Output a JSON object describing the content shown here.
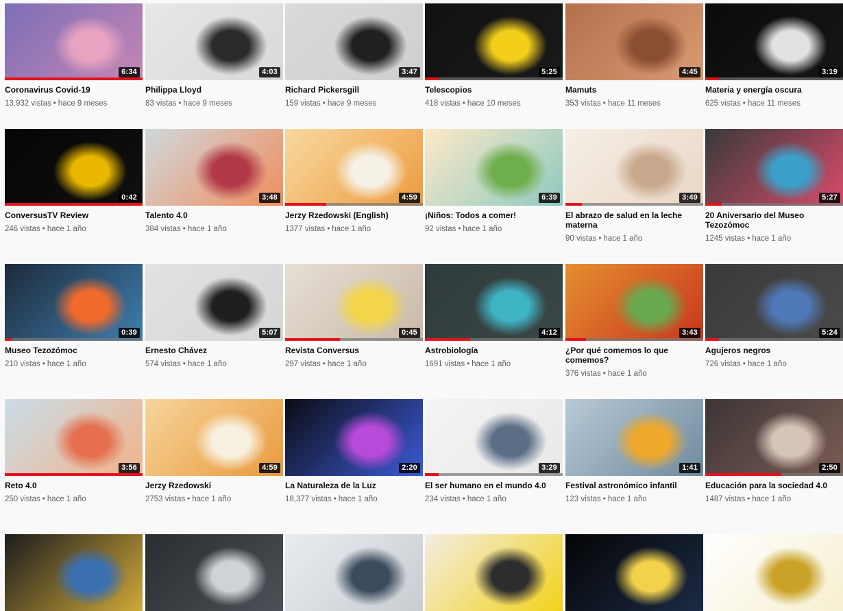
{
  "videos": [
    {
      "title": "Coronavirus Covid-19",
      "views": "13,932 vistas",
      "age": "hace 9 meses",
      "duration": "6:34",
      "progress": 1.0,
      "thumb_colors": [
        "#7c6fb8",
        "#c486b3",
        "#e7a3c0"
      ]
    },
    {
      "title": "Philippa Lloyd",
      "views": "83 vistas",
      "age": "hace 9 meses",
      "duration": "4:03",
      "progress": 0,
      "thumb_colors": [
        "#e7e7e7",
        "#d9d9d9",
        "#2a2a2a"
      ]
    },
    {
      "title": "Richard Pickersgill",
      "views": "159 vistas",
      "age": "hace 9 meses",
      "duration": "3:47",
      "progress": 0,
      "thumb_colors": [
        "#dadada",
        "#cfcfcf",
        "#202020"
      ]
    },
    {
      "title": "Telescopios",
      "views": "418 vistas",
      "age": "hace 10 meses",
      "duration": "5:25",
      "progress": 0.1,
      "thumb_colors": [
        "#111111",
        "#1a1a1a",
        "#f3cf1c"
      ]
    },
    {
      "title": "Mamuts",
      "views": "353 vistas",
      "age": "hace 11 meses",
      "duration": "4:45",
      "progress": 0,
      "thumb_colors": [
        "#b5704a",
        "#d99a74",
        "#8a4f32"
      ]
    },
    {
      "title": "Materia y energía oscura",
      "views": "625 vistas",
      "age": "hace 11 meses",
      "duration": "3:19",
      "progress": 0.1,
      "thumb_colors": [
        "#0b0b0b",
        "#161616",
        "#e2e2e2"
      ]
    },
    {
      "title": "ConversusTV Review",
      "views": "246 vistas",
      "age": "hace 1 año",
      "duration": "0:42",
      "progress": 1.0,
      "thumb_colors": [
        "#050505",
        "#101010",
        "#e9b700"
      ]
    },
    {
      "title": "Talento 4.0",
      "views": "384 vistas",
      "age": "hace 1 año",
      "duration": "3:48",
      "progress": 0,
      "thumb_colors": [
        "#cfd8dc",
        "#f08d5c",
        "#b23a48"
      ]
    },
    {
      "title": "Jerzy Rzedowski (English)",
      "views": "1377 vistas",
      "age": "hace 1 año",
      "duration": "4:59",
      "progress": 0.3,
      "thumb_colors": [
        "#f8d9a0",
        "#ec9b3e",
        "#f6f1e6"
      ]
    },
    {
      "title": "¡Niños: Todos a comer!",
      "views": "92 vistas",
      "age": "hace 1 año",
      "duration": "6:39",
      "progress": 0,
      "thumb_colors": [
        "#fde9c8",
        "#8ec9c0",
        "#6fae4c"
      ]
    },
    {
      "title": "El abrazo de salud en la leche materna",
      "views": "90 vistas",
      "age": "hace 1 año",
      "duration": "3:49",
      "progress": 0.12,
      "thumb_colors": [
        "#f5efe7",
        "#e9d6c4",
        "#c9a98d"
      ]
    },
    {
      "title": "20 Aniversario del Museo Tezozómoc",
      "views": "1245 vistas",
      "age": "hace 1 año",
      "duration": "5:27",
      "progress": 0.12,
      "thumb_colors": [
        "#3a3a3a",
        "#d94b6a",
        "#3aa0c9"
      ]
    },
    {
      "title": "Museo Tezozómoc",
      "views": "210 vistas",
      "age": "hace 1 año",
      "duration": "0:39",
      "progress": 0.05,
      "thumb_colors": [
        "#1d2a3a",
        "#3f7fb0",
        "#f06a2c"
      ]
    },
    {
      "title": "Ernesto Chávez",
      "views": "574 vistas",
      "age": "hace 1 año",
      "duration": "5:07",
      "progress": 0,
      "thumb_colors": [
        "#e2e2e2",
        "#d6d6d6",
        "#1f1f1f"
      ]
    },
    {
      "title": "Revista Conversus",
      "views": "297 vistas",
      "age": "hace 1 año",
      "duration": "0:45",
      "progress": 0.4,
      "thumb_colors": [
        "#e6dfd6",
        "#c9b9a8",
        "#f2d54b"
      ]
    },
    {
      "title": "Astrobiología",
      "views": "1691 vistas",
      "age": "hace 1 año",
      "duration": "4:12",
      "progress": 0.33,
      "thumb_colors": [
        "#2f3a3a",
        "#3c4747",
        "#3fb4c5"
      ]
    },
    {
      "title": "¿Por qué comemos lo que comemos?",
      "views": "376 vistas",
      "age": "hace 1 año",
      "duration": "3:43",
      "progress": 0.15,
      "thumb_colors": [
        "#e48f2f",
        "#c8361e",
        "#6aa84f"
      ]
    },
    {
      "title": "Agujeros negros",
      "views": "726 vistas",
      "age": "hace 1 año",
      "duration": "5:24",
      "progress": 0.1,
      "thumb_colors": [
        "#3a3a3a",
        "#4a4a4a",
        "#4f79b8"
      ]
    },
    {
      "title": "Reto 4.0",
      "views": "250 vistas",
      "age": "hace 1 año",
      "duration": "3:56",
      "progress": 1.0,
      "thumb_colors": [
        "#c9dde8",
        "#f2b38a",
        "#e56f4e"
      ]
    },
    {
      "title": "Jerzy Rzedowski",
      "views": "2753 vistas",
      "age": "hace 1 año",
      "duration": "4:59",
      "progress": 0,
      "thumb_colors": [
        "#f6d49b",
        "#ea9a3d",
        "#f8f1e2"
      ]
    },
    {
      "title": "La Naturaleza de la Luz",
      "views": "18,377 vistas",
      "age": "hace 1 año",
      "duration": "2:20",
      "progress": 0,
      "thumb_colors": [
        "#0c0c14",
        "#3b5bd6",
        "#b74ad9"
      ]
    },
    {
      "title": "El ser humano en el mundo 4.0",
      "views": "234 vistas",
      "age": "hace 1 año",
      "duration": "3:29",
      "progress": 0.1,
      "thumb_colors": [
        "#f4f4f4",
        "#e8e8e8",
        "#5b6e86"
      ]
    },
    {
      "title": "Festival astronómico infantil",
      "views": "123 vistas",
      "age": "hace 1 año",
      "duration": "1:41",
      "progress": 0,
      "thumb_colors": [
        "#b8c9d6",
        "#6f8a9d",
        "#f0a82a"
      ]
    },
    {
      "title": "Educación para la sociedad 4.0",
      "views": "1487 vistas",
      "age": "hace 1 año",
      "duration": "2:50",
      "progress": 0.55,
      "thumb_colors": [
        "#3d3536",
        "#7a5c55",
        "#d7c4b8"
      ]
    },
    {
      "title": "",
      "views": "",
      "age": "",
      "duration": "",
      "progress": 0,
      "thumb_colors": [
        "#1c1c1c",
        "#cfa93a",
        "#3a6fb0"
      ]
    },
    {
      "title": "",
      "views": "",
      "age": "",
      "duration": "",
      "progress": 0,
      "thumb_colors": [
        "#2a2d30",
        "#4b5157",
        "#cfd3d6"
      ]
    },
    {
      "title": "",
      "views": "",
      "age": "",
      "duration": "",
      "progress": 0,
      "thumb_colors": [
        "#e9ecef",
        "#c8cdd2",
        "#3b4a5c"
      ]
    },
    {
      "title": "",
      "views": "",
      "age": "",
      "duration": "",
      "progress": 0,
      "thumb_colors": [
        "#f3ede3",
        "#f3d21b",
        "#2d2d2d"
      ]
    },
    {
      "title": "",
      "views": "",
      "age": "",
      "duration": "",
      "progress": 0,
      "thumb_colors": [
        "#050505",
        "#1b2a45",
        "#f2d24a"
      ]
    },
    {
      "title": "",
      "views": "",
      "age": "",
      "duration": "",
      "progress": 0,
      "thumb_colors": [
        "#ffffff",
        "#f6efd0",
        "#c9a227"
      ]
    }
  ]
}
